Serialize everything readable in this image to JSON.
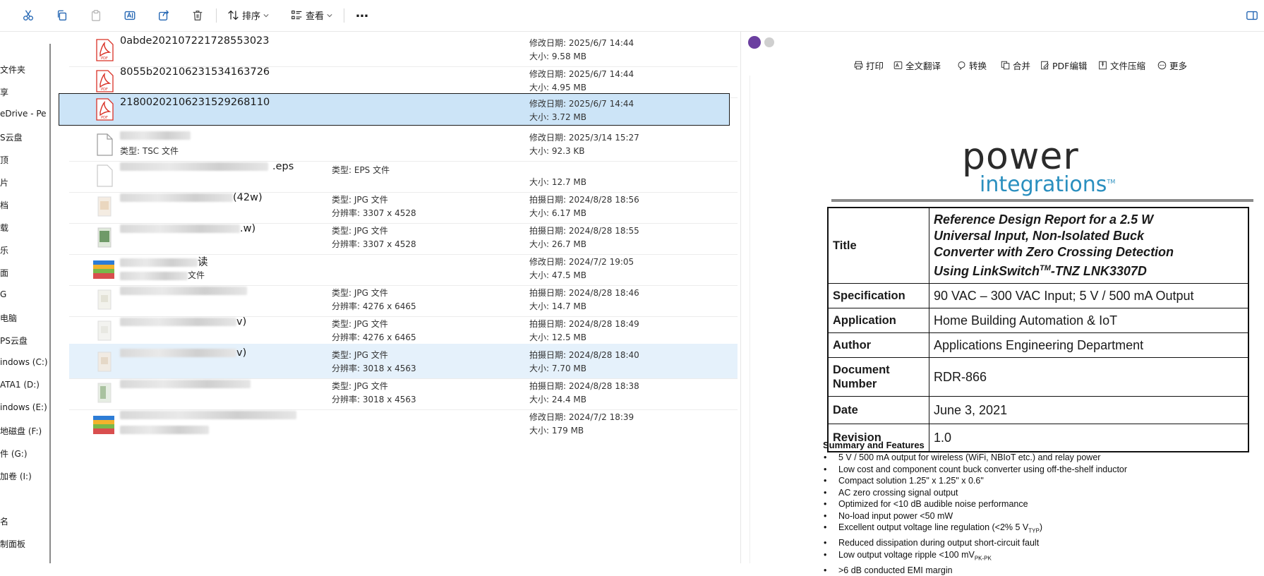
{
  "toolbar": {
    "sort_label": "排序",
    "view_label": "查看",
    "more_label": "…"
  },
  "nav": {
    "items": [
      "文件夹",
      "享",
      "eDrive - Pe",
      "S云盘",
      "顶",
      "片",
      "档",
      "载",
      "乐",
      "面",
      "G",
      "电脑",
      "PS云盘",
      "indows (C:)",
      "ATA1 (D:)",
      "indows (E:)",
      "地磁盘 (F:)",
      "件 (G:)",
      "加卷 (I:)",
      "名",
      "制面板"
    ]
  },
  "files": [
    {
      "name": "0abde202107221728553023",
      "icon": "pdf-icon",
      "meta1": "修改日期: 2025/6/7 14:44",
      "meta2": "大小: 9.58 MB"
    },
    {
      "name": "8055b202106231534163726",
      "icon": "pdf-icon",
      "meta1": "修改日期: 2025/6/7 14:44",
      "meta2": "大小: 4.95 MB"
    },
    {
      "name": "21800202106231529268110",
      "icon": "pdf-icon",
      "meta1": "修改日期: 2025/6/7 14:44",
      "meta2": "大小: 3.72 MB",
      "selected": true
    },
    {
      "name": "",
      "sub": "类型: TSC 文件",
      "icon": "blank-file-icon",
      "meta1": "修改日期: 2025/3/14 15:27",
      "meta2": "大小: 92.3 KB"
    },
    {
      "name": ".eps",
      "type1": "类型: EPS 文件",
      "icon": "eps-file-icon",
      "meta1": "",
      "meta2": "大小: 12.7 MB"
    },
    {
      "name": "(42w)",
      "type1": "类型: JPG 文件",
      "type2": "分辨率: 3307 x 4528",
      "icon": "image-thumbnail-icon",
      "meta1": "拍摄日期: 2024/8/28 18:56",
      "meta2": "大小: 6.17 MB"
    },
    {
      "name": ".w)",
      "type1": "类型: JPG 文件",
      "type2": "分辨率: 3307 x 4528",
      "icon": "image-thumbnail-icon",
      "meta1": "拍摄日期: 2024/8/28 18:55",
      "meta2": "大小: 26.7 MB"
    },
    {
      "name": "读",
      "sub": "文件",
      "icon": "archive-icon",
      "meta1": "修改日期: 2024/7/2 19:05",
      "meta2": "大小: 47.5 MB"
    },
    {
      "name": "",
      "type1": "类型: JPG 文件",
      "type2": "分辨率: 4276 x 6465",
      "icon": "image-thumbnail-icon",
      "meta1": "拍摄日期: 2024/8/28 18:46",
      "meta2": "大小: 14.7 MB"
    },
    {
      "name": "v)",
      "type1": "类型: JPG 文件",
      "type2": "分辨率: 4276 x 6465",
      "icon": "image-thumbnail-icon",
      "meta1": "拍摄日期: 2024/8/28 18:49",
      "meta2": "大小: 12.5 MB"
    },
    {
      "name": "v)",
      "type1": "类型: JPG 文件",
      "type2": "分辨率: 3018 x 4563",
      "icon": "image-thumbnail-icon",
      "meta1": "拍摄日期: 2024/8/28 18:40",
      "meta2": "大小: 7.70 MB",
      "hovered": true
    },
    {
      "name": "",
      "type1": "类型: JPG 文件",
      "type2": "分辨率: 3018 x 4563",
      "icon": "image-thumbnail-icon",
      "meta1": "拍摄日期: 2024/8/28 18:38",
      "meta2": "大小: 24.4 MB"
    },
    {
      "name": "",
      "icon": "archive-icon",
      "meta1": "修改日期: 2024/7/2 18:39",
      "meta2": "大小: 179 MB"
    }
  ],
  "preview": {
    "buttons": [
      "打印",
      "全文翻译",
      "转换",
      "合并",
      "PDF编辑",
      "文件压缩",
      "更多"
    ],
    "logo_power": "power",
    "logo_integrations": "integrations",
    "logo_tm": "TM",
    "table": {
      "title_key": "Title",
      "title_value_line1": "Reference Design Report for a 2.5 W",
      "title_value_line2": "Universal Input, Non-Isolated Buck",
      "title_value_line3": "Converter with Zero Crossing Detection",
      "title_value_line4a": "Using LinkSwitch",
      "title_value_tm": "TM",
      "title_value_line4b": "-TNZ LNK3307D",
      "rows": [
        {
          "key": "Specification",
          "value": "90 VAC – 300 VAC Input; 5 V / 500 mA Output"
        },
        {
          "key": "Application",
          "value": "Home Building Automation & IoT"
        },
        {
          "key": "Author",
          "value": "Applications Engineering Department"
        },
        {
          "key": "Document Number",
          "value": "RDR-866"
        },
        {
          "key": "Date",
          "value": "June 3, 2021"
        },
        {
          "key": "Revision",
          "value": "1.0"
        }
      ]
    },
    "summary": {
      "heading": "Summary and Features",
      "items": [
        "5 V / 500 mA output for wireless (WiFi, NBIoT etc.) and relay power",
        "Low cost and component count buck converter using off-the-shelf inductor",
        "Compact solution 1.25\" x 1.25\" x 0.6\"",
        "AC zero crossing signal output",
        "Optimized for <10 dB audible noise performance",
        "No-load input power <50 mW",
        "Excellent output voltage line regulation (<2% 5 V",
        "Reduced dissipation during output short-circuit fault",
        "Low output voltage ripple <100 mV",
        ">6 dB conducted EMI margin"
      ],
      "item7_sub": "TYP",
      "item7_tail": ")",
      "item9_sub": "PK-PK"
    }
  },
  "colors": {
    "selected_row": "#cce4f7",
    "hovered_row": "#e5f1fb",
    "pdf_red": "#d93025",
    "brand_blue": "#2a8fbf"
  }
}
